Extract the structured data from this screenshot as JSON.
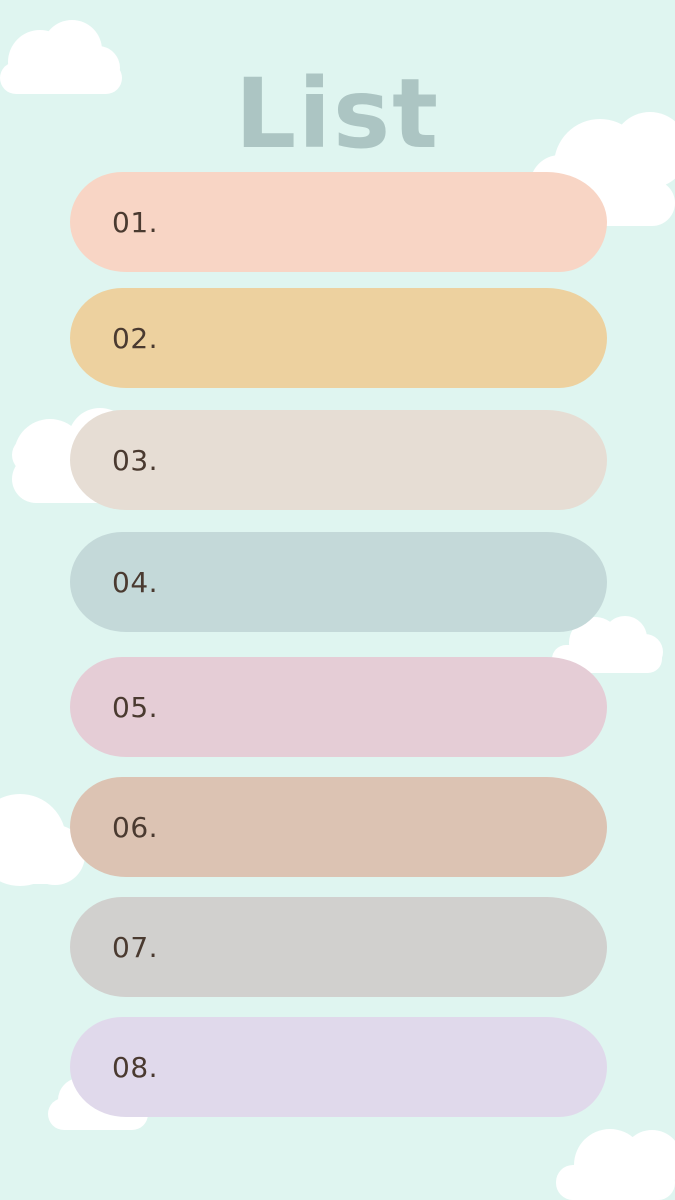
{
  "title": "List",
  "colors": {
    "background": "#dff5f0",
    "title": "#acc5c3",
    "label_text": "#4a3a30",
    "cloud": "#ffffff"
  },
  "items": [
    {
      "label": "01.",
      "color": "#f8d5c5"
    },
    {
      "label": "02.",
      "color": "#edd19f"
    },
    {
      "label": "03.",
      "color": "#e6ddd4"
    },
    {
      "label": "04.",
      "color": "#c4d9d9"
    },
    {
      "label": "05.",
      "color": "#e5cdd6"
    },
    {
      "label": "06.",
      "color": "#dcc3b3"
    },
    {
      "label": "07.",
      "color": "#d1d0ce"
    },
    {
      "label": "08.",
      "color": "#e0d9eb"
    }
  ]
}
